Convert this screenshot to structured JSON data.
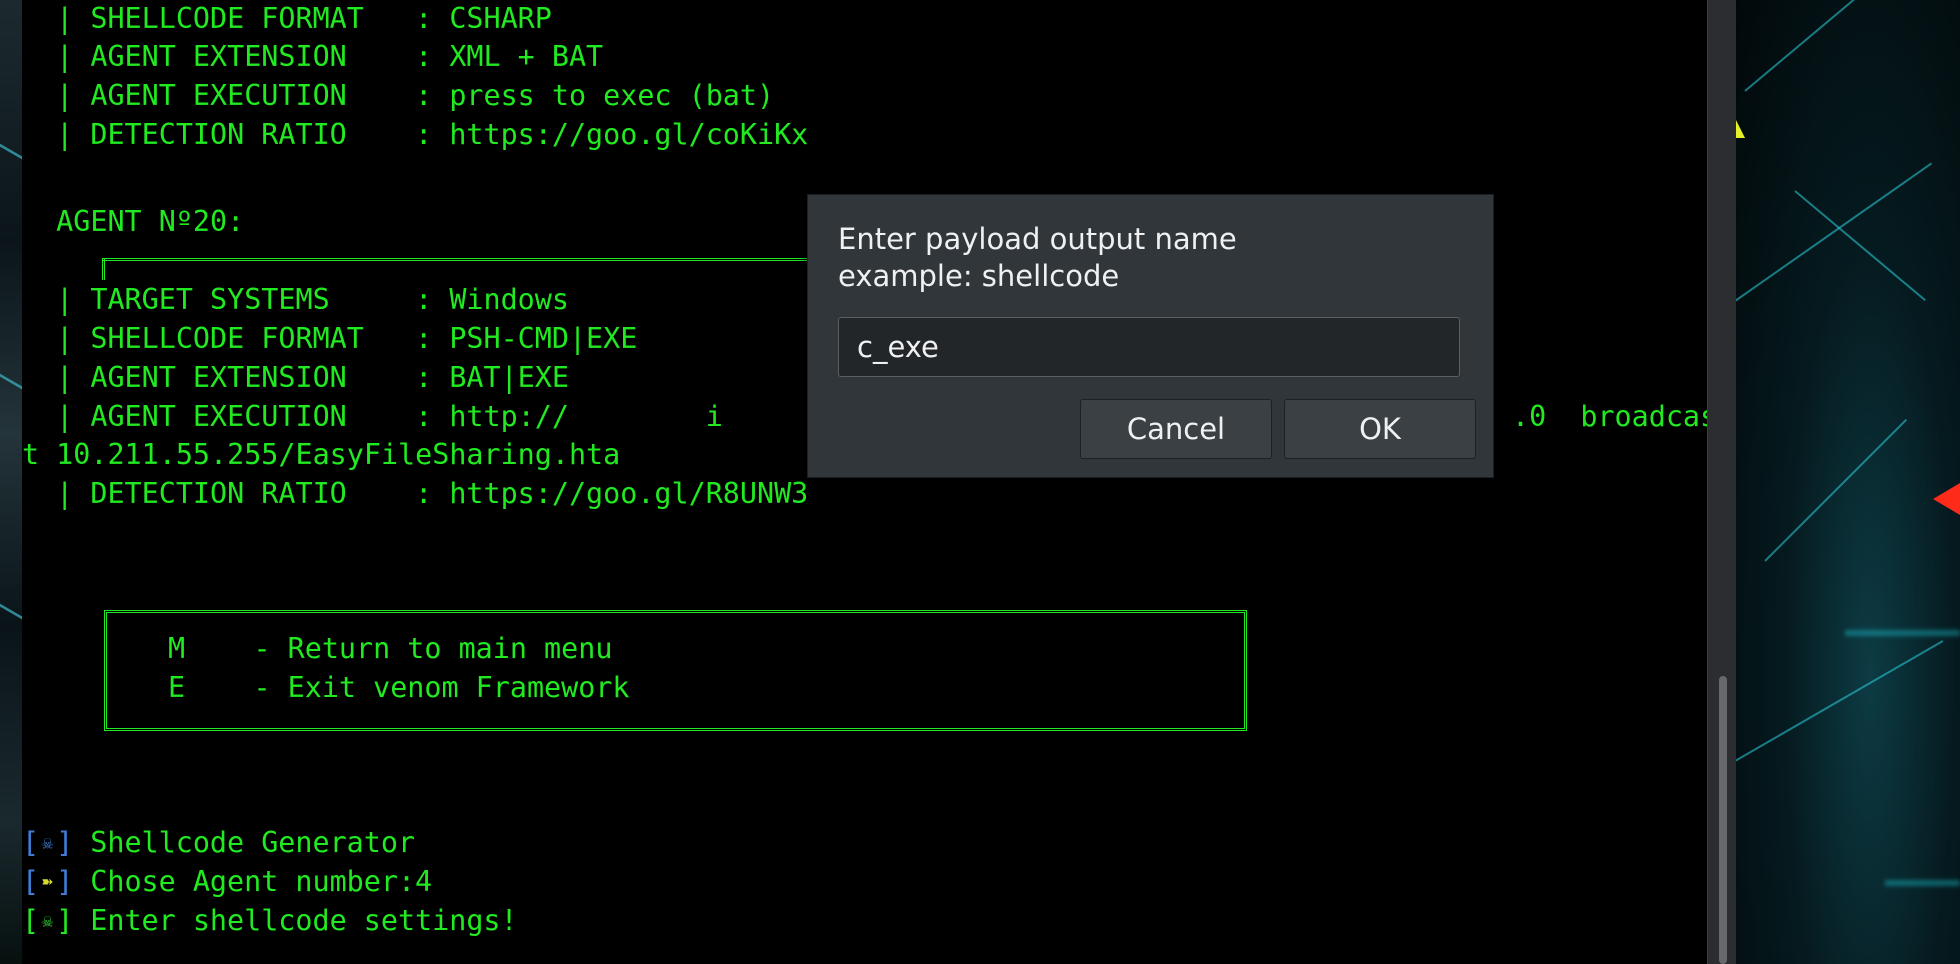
{
  "terminal": {
    "agent19": {
      "shellcode_format": "  | SHELLCODE FORMAT   : CSHARP",
      "agent_extension": "  | AGENT EXTENSION    : XML + BAT",
      "agent_execution": "  | AGENT EXECUTION    : press to exec (bat)",
      "detection_ratio": "  | DETECTION RATIO    : https://goo.gl/coKiKx"
    },
    "agent20": {
      "heading": "  AGENT Nº20:",
      "target_systems": "  | TARGET SYSTEMS     : Windows",
      "shellcode_format": "  | SHELLCODE FORMAT   : PSH-CMD|EXE",
      "agent_extension": "  | AGENT EXTENSION    : BAT|EXE",
      "agent_execution_start": "  | AGENT EXECUTION    : http://        i",
      "agent_execution_tail": ".0  broadcas",
      "agent_execution_wrap": "t 10.211.55.255/EasyFileSharing.hta",
      "detection_ratio": "  | DETECTION RATIO    : https://goo.gl/R8UNW3"
    },
    "menu": {
      "return_item": "M    - Return to main menu",
      "exit_item": "E    - Exit venom Framework"
    },
    "status": {
      "line1": "Shellcode Generator",
      "line2": "Chose Agent number:4",
      "line3": "Enter shellcode settings!"
    }
  },
  "dialog": {
    "message_line1": "Enter payload output name",
    "message_line2": "example: shellcode",
    "input_value": "c_exe",
    "cancel_label": "Cancel",
    "ok_label": "OK"
  },
  "colors": {
    "terminal_text": "#21ea21",
    "terminal_bg": "#000000",
    "dialog_bg": "#31363b",
    "bracket_blue": "#3d7fd8"
  }
}
